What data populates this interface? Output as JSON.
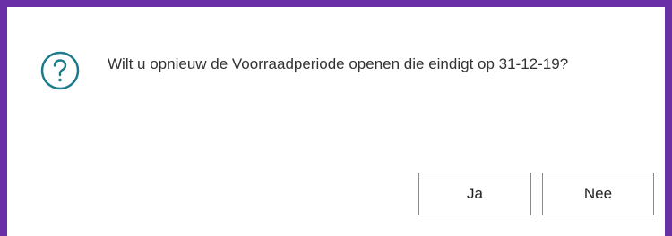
{
  "dialog": {
    "icon": "question-circle-icon",
    "message": "Wilt u opnieuw de Voorraadperiode openen die eindigt op 31-12-19?",
    "buttons": {
      "yes_label": "Ja",
      "no_label": "Nee"
    }
  },
  "colors": {
    "border": "#6b2fa5",
    "icon": "#1b7a8c",
    "text": "#333333",
    "button_border": "#8a8a8a"
  }
}
